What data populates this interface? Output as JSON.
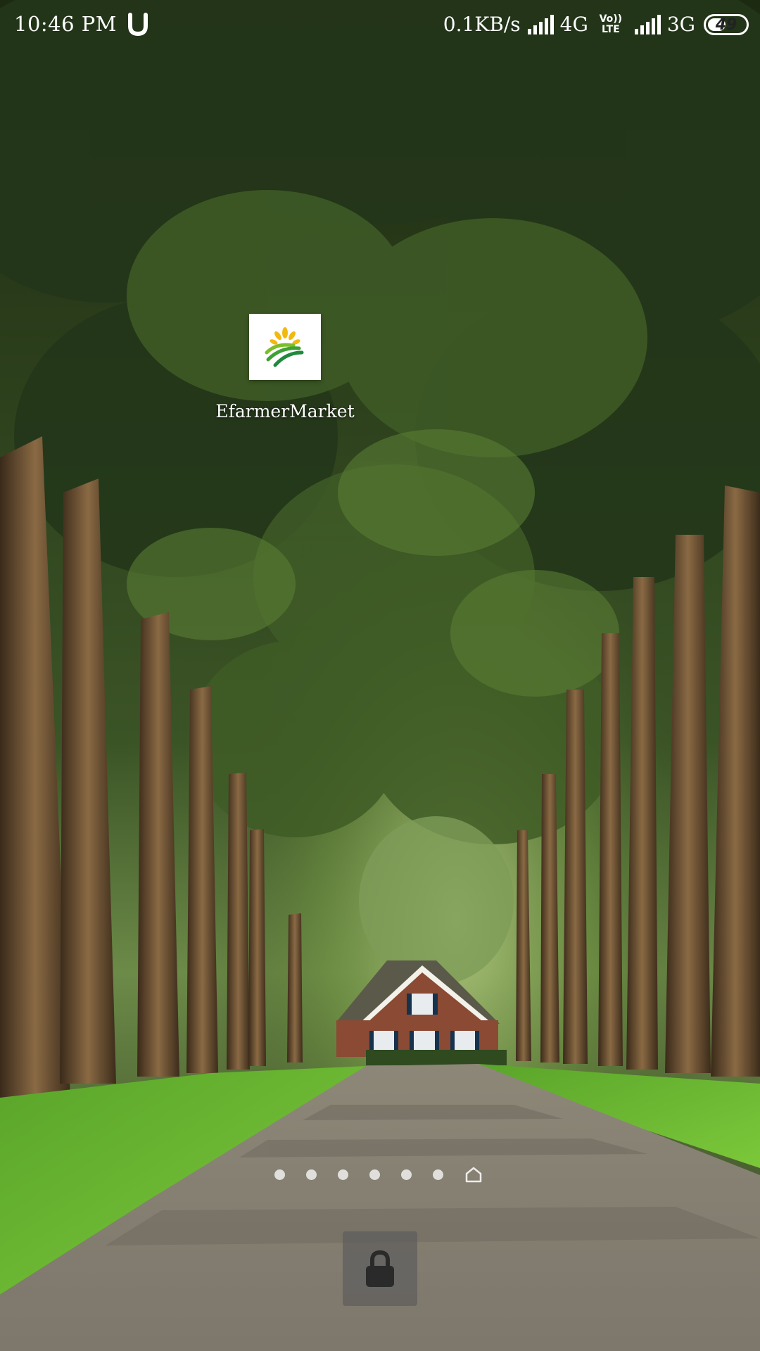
{
  "status_bar": {
    "time": "10:46 PM",
    "network_speed": "0.1KB/s",
    "network_type_1": "4G",
    "volte_top": "Vo))",
    "volte_bottom": "LTE",
    "network_type_2": "3G",
    "battery_level": "49",
    "battery_fraction": 0.49
  },
  "home_screen": {
    "apps": [
      {
        "label": "EfarmerMarket",
        "icon": "efarmermarket-logo"
      }
    ],
    "page_indicator": {
      "dot_count": 6,
      "home_icon": "home-icon"
    },
    "lock_button_icon": "lock-icon"
  },
  "wallpaper": {
    "description_icon": "forest-road-wallpaper"
  }
}
